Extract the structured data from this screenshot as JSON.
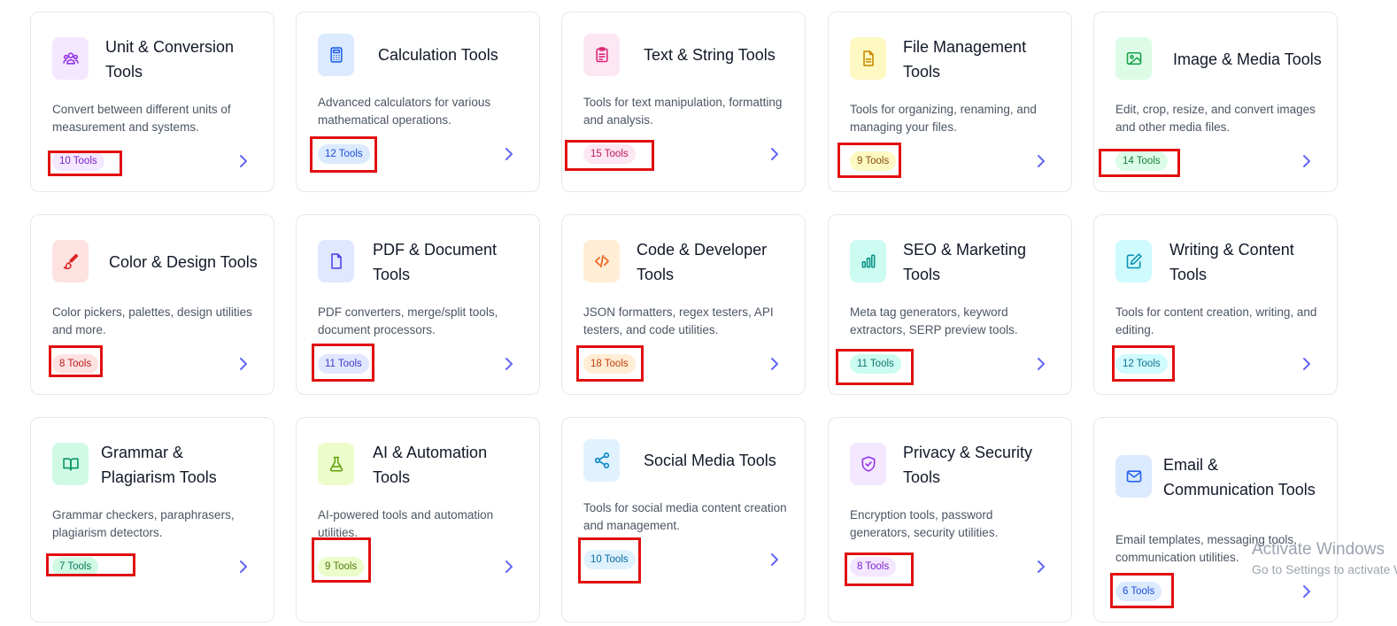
{
  "cards": [
    {
      "title": "Unit & Conversion Tools",
      "description": "Convert between different units of measurement and systems.",
      "badge": "10 Tools",
      "icon": "users-icon",
      "icon_bg": "#f3e8ff",
      "icon_color": "#9333ea",
      "badge_bg": "#f3e8ff",
      "badge_color": "#7e22ce"
    },
    {
      "title": "Calculation Tools",
      "description": "Advanced calculators for various mathematical operations.",
      "badge": "12 Tools",
      "icon": "calculator-icon",
      "icon_bg": "#dbeafe",
      "icon_color": "#2563eb",
      "badge_bg": "#dbeafe",
      "badge_color": "#1d4ed8"
    },
    {
      "title": "Text & String Tools",
      "description": "Tools for text manipulation, formatting and analysis.",
      "badge": "15 Tools",
      "icon": "clipboard-icon",
      "icon_bg": "#fce7f3",
      "icon_color": "#db2777",
      "badge_bg": "#fce7f3",
      "badge_color": "#be185d"
    },
    {
      "title": "File Management Tools",
      "description": "Tools for organizing, renaming, and managing your files.",
      "badge": "9 Tools",
      "icon": "file-icon",
      "icon_bg": "#fef9c3",
      "icon_color": "#ca8a04",
      "badge_bg": "#fef9c3",
      "badge_color": "#854d0e"
    },
    {
      "title": "Image & Media Tools",
      "description": "Edit, crop, resize, and convert images and other media files.",
      "badge": "14 Tools",
      "icon": "image-icon",
      "icon_bg": "#dcfce7",
      "icon_color": "#16a34a",
      "badge_bg": "#dcfce7",
      "badge_color": "#15803d"
    },
    {
      "title": "Color & Design Tools",
      "description": "Color pickers, palettes, design utilities and more.",
      "badge": "8 Tools",
      "icon": "brush-icon",
      "icon_bg": "#fee2e2",
      "icon_color": "#dc2626",
      "badge_bg": "#fee2e2",
      "badge_color": "#b91c1c"
    },
    {
      "title": "PDF & Document Tools",
      "description": "PDF converters, merge/split tools, document processors.",
      "badge": "11 Tools",
      "icon": "document-icon",
      "icon_bg": "#e0e7ff",
      "icon_color": "#4f46e5",
      "badge_bg": "#e0e7ff",
      "badge_color": "#4338ca"
    },
    {
      "title": "Code & Developer Tools",
      "description": "JSON formatters, regex testers, API testers, and code utilities.",
      "badge": "18 Tools",
      "icon": "code-icon",
      "icon_bg": "#ffedd5",
      "icon_color": "#ea580c",
      "badge_bg": "#ffedd5",
      "badge_color": "#c2410c"
    },
    {
      "title": "SEO & Marketing Tools",
      "description": "Meta tag generators, keyword extractors, SERP preview tools.",
      "badge": "11 Tools",
      "icon": "bar-chart-icon",
      "icon_bg": "#ccfbf1",
      "icon_color": "#0d9488",
      "badge_bg": "#ccfbf1",
      "badge_color": "#0f766e"
    },
    {
      "title": "Writing & Content Tools",
      "description": "Tools for content creation, writing, and editing.",
      "badge": "12 Tools",
      "icon": "edit-icon",
      "icon_bg": "#cffafe",
      "icon_color": "#0891b2",
      "badge_bg": "#cffafe",
      "badge_color": "#0e7490"
    },
    {
      "title": "Grammar & Plagiarism Tools",
      "description": "Grammar checkers, paraphrasers, plagiarism detectors.",
      "badge": "7 Tools",
      "icon": "book-icon",
      "icon_bg": "#d1fae5",
      "icon_color": "#059669",
      "badge_bg": "#d1fae5",
      "badge_color": "#047857"
    },
    {
      "title": "AI & Automation Tools",
      "description": "AI-powered tools and automation utilities.",
      "badge": "9 Tools",
      "icon": "flask-icon",
      "icon_bg": "#ecfccb",
      "icon_color": "#65a30d",
      "badge_bg": "#ecfccb",
      "badge_color": "#4d7c0f"
    },
    {
      "title": "Social Media Tools",
      "description": "Tools for social media content creation and management.",
      "badge": "10 Tools",
      "icon": "share-icon",
      "icon_bg": "#e0f2fe",
      "icon_color": "#0284c7",
      "badge_bg": "#e0f2fe",
      "badge_color": "#0369a1"
    },
    {
      "title": "Privacy & Security Tools",
      "description": "Encryption tools, password generators, security utilities.",
      "badge": "8 Tools",
      "icon": "shield-check-icon",
      "icon_bg": "#f3e8ff",
      "icon_color": "#9333ea",
      "badge_bg": "#f3e8ff",
      "badge_color": "#7e22ce"
    },
    {
      "title": "Email & Communication Tools",
      "description": "Email templates, messaging tools, communication utilities.",
      "badge": "6 Tools",
      "icon": "mail-icon",
      "icon_bg": "#dbeafe",
      "icon_color": "#2563eb",
      "badge_bg": "#dbeafe",
      "badge_color": "#1d4ed8"
    }
  ],
  "chevron_icon": "chevron-right-icon",
  "chevron_color": "#6366f1",
  "highlight_color": "#e11010",
  "watermark": {
    "line1": "Activate Windows",
    "line2": "Go to Settings to activate Windows."
  }
}
